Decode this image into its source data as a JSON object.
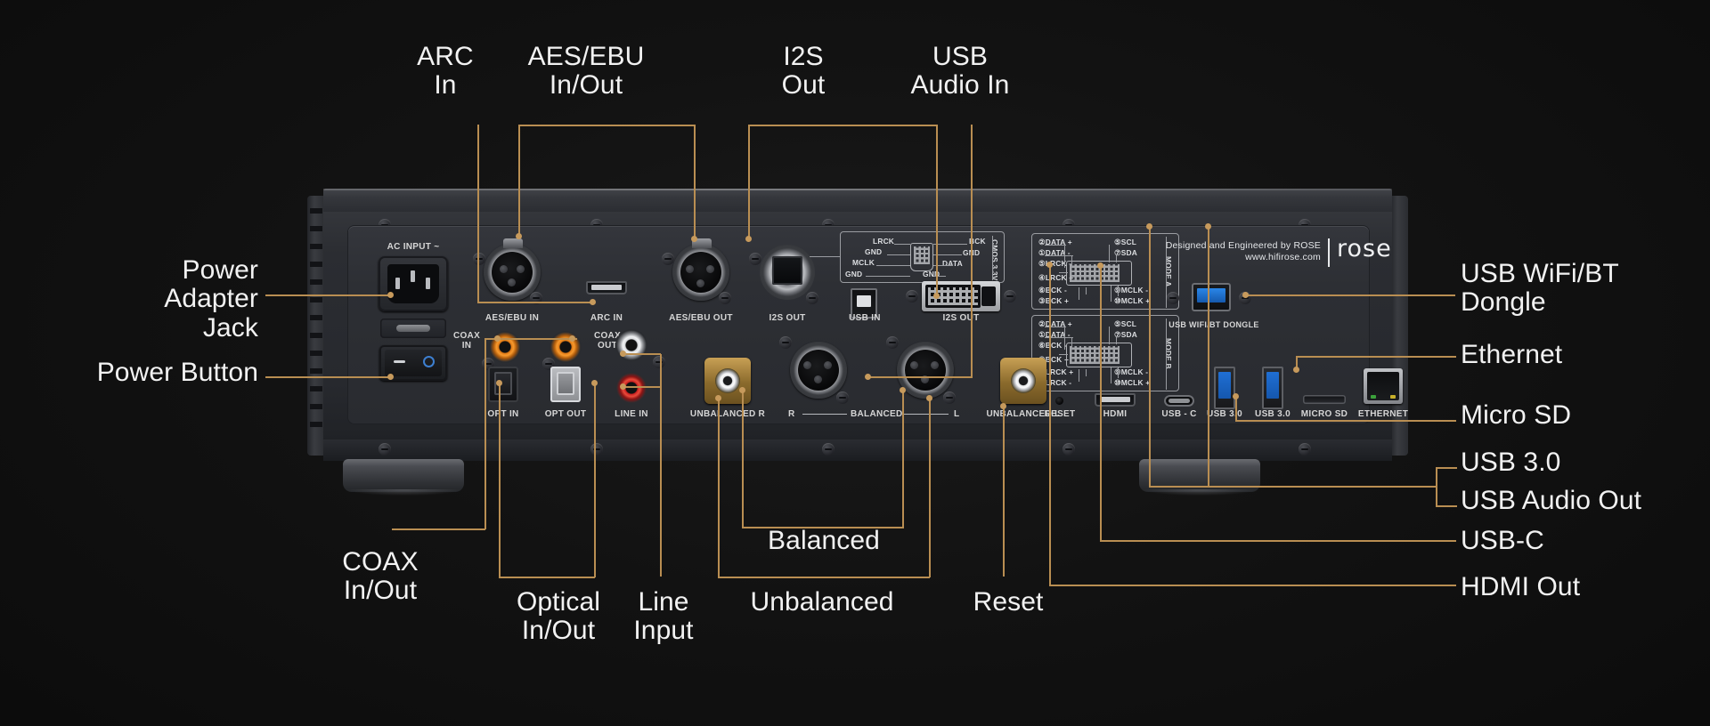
{
  "product": {
    "brand_logo": "rose",
    "designed_by": "Designed and Engineered by ROSE",
    "website": "www.hifirose.com"
  },
  "callouts": {
    "top": [
      {
        "id": "arc-in",
        "text": "ARC\nIn"
      },
      {
        "id": "aes-ebu",
        "text": "AES/EBU\nIn/Out"
      },
      {
        "id": "i2s-out",
        "text": "I2S\nOut"
      },
      {
        "id": "usb-audio-in",
        "text": "USB\nAudio In"
      }
    ],
    "left": [
      {
        "id": "power-adapter-jack",
        "text": "Power\nAdapter Jack"
      },
      {
        "id": "power-button",
        "text": "Power Button"
      }
    ],
    "right": [
      {
        "id": "usb-wifi-bt-dongle",
        "text": "USB WiFi/BT\nDongle"
      },
      {
        "id": "ethernet",
        "text": "Ethernet"
      },
      {
        "id": "micro-sd",
        "text": "Micro SD"
      },
      {
        "id": "usb-30",
        "text": "USB 3.0"
      },
      {
        "id": "usb-audio-out",
        "text": "USB Audio Out"
      },
      {
        "id": "usb-c",
        "text": "USB-C"
      },
      {
        "id": "hdmi-out",
        "text": "HDMI Out"
      }
    ],
    "bottom": [
      {
        "id": "coax-in-out",
        "text": "COAX\nIn/Out"
      },
      {
        "id": "optical-in-out",
        "text": "Optical\nIn/Out"
      },
      {
        "id": "line-input",
        "text": "Line\nInput"
      },
      {
        "id": "balanced",
        "text": "Balanced"
      },
      {
        "id": "unbalanced",
        "text": "Unbalanced"
      },
      {
        "id": "reset",
        "text": "Reset"
      }
    ]
  },
  "panel_labels": {
    "ac_input": "AC INPUT ~",
    "aes_ebu_in": "AES/EBU IN",
    "arc_in": "ARC IN",
    "aes_ebu_out": "AES/EBU OUT",
    "i2s_out_rj": "I2S OUT",
    "usb_in": "USB IN",
    "i2s_out_dvi": "I2S OUT",
    "coax_in": "COAX\nIN",
    "coax_out": "COAX\nOUT",
    "opt_in": "OPT IN",
    "opt_out": "OPT OUT",
    "line_in": "LINE IN",
    "unbalanced_r": "UNBALANCED R",
    "balanced_r": "R",
    "balanced": "BALANCED",
    "balanced_l": "L",
    "unbalanced_l": "UNBALANCED L",
    "usb_wifi_bt_dongle": "USB WIFI/BT DONGLE",
    "reset": "RESET",
    "hdmi": "HDMI",
    "usb_c": "USB - C",
    "usb_30_a": "USB 3.0",
    "usb_30_b": "USB 3.0",
    "micro_sd": "MICRO SD",
    "ethernet": "ETHERNET"
  },
  "i2s_rj_diagram": {
    "left_labels": [
      "LRCK",
      "GND",
      "MCLK",
      "GND"
    ],
    "right_labels": [
      "BCK",
      "GND",
      "DATA",
      "GND"
    ],
    "side_label": "CMOS 3.3V"
  },
  "i2s_dvi_diagram": {
    "mode_a": {
      "title": "MODE A",
      "left": [
        "②DATA +",
        "①DATA -",
        "⑤LRCK -",
        "④LRCK +",
        "⑥BCK -",
        "③BCK +"
      ],
      "right": [
        "⑤SCL",
        "⑦SDA",
        "⑨MCLK -",
        "⑩MCLK +"
      ]
    },
    "mode_b": {
      "title": "MODE B",
      "left": [
        "②DATA +",
        "①DATA -",
        "⑥BCK -",
        "③BCK +",
        "④LRCK +",
        "⑤LRCK -"
      ],
      "right": [
        "⑤SCL",
        "⑦SDA",
        "⑨MCLK -",
        "⑩MCLK +"
      ]
    }
  },
  "colors": {
    "leader_line": "#b98e52",
    "label_text": "#f2f2f2",
    "background": "#0d0d0d",
    "chassis": "#2b2d32",
    "usb3_blue": "#1f6fd4",
    "rca_orange": "#e07a16",
    "rca_red": "#cc2222",
    "gold": "#c8a055"
  }
}
